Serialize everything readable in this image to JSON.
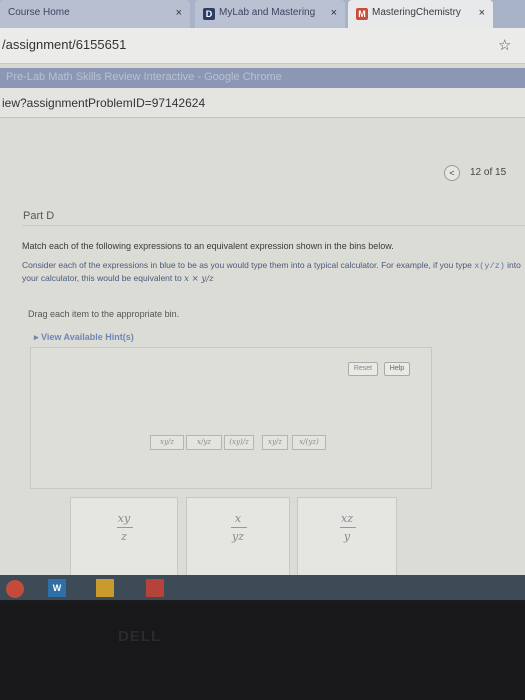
{
  "browser": {
    "tabs": [
      {
        "label": "Course Home",
        "close": "×"
      },
      {
        "label": "MyLab and Mastering",
        "favicon": "D",
        "close": "×"
      },
      {
        "label": "MasteringChemistry",
        "favicon": "M",
        "close": "×"
      }
    ],
    "address": "/assignment/6155651",
    "bookmark_star": "☆"
  },
  "second_window": {
    "title": "Pre-Lab Math Skills Review Interactive - Google Chrome",
    "address": "iew?assignmentProblemID=97142624"
  },
  "navigation": {
    "prev_icon": "<",
    "page_indicator": "12 of 15"
  },
  "problem": {
    "part_label": "Part D",
    "instruction": "Match each of the following expressions to an equivalent expression shown in the bins below.",
    "example_text": "Consider each of the expressions in blue to be as you would type them into a typical calculator. For example, if you type",
    "example_code": "x(y/z)",
    "example_text2": "into your calculator, this would be equivalent to",
    "example_math": "x × y/z",
    "drag_instruction": "Drag each item to the appropriate bin.",
    "hint_link": "▸ View Available Hint(s)"
  },
  "drag_area": {
    "reset_label": "Reset",
    "help_label": "Help",
    "items": [
      "xy/z",
      "x/yz",
      "(xy)/z",
      "xy/z",
      "x/(yz)"
    ]
  },
  "bins": [
    {
      "numerator": "xy",
      "denominator": "z"
    },
    {
      "numerator": "x",
      "denominator": "yz"
    },
    {
      "numerator": "xz",
      "denominator": "y"
    }
  ],
  "taskbar": {
    "apps": [
      "W",
      "",
      ""
    ]
  },
  "monitor_brand": "DELL"
}
